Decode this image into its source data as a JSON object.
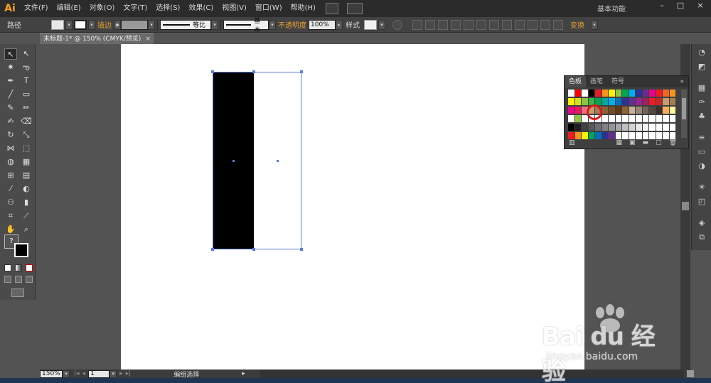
{
  "app": {
    "logo": "Ai"
  },
  "menu": [
    "文件(F)",
    "编辑(E)",
    "对象(O)",
    "文字(T)",
    "选择(S)",
    "效果(C)",
    "视图(V)",
    "窗口(W)",
    "帮助(H)"
  ],
  "workspace": "基本功能",
  "window_controls": {
    "minimize": "–",
    "maximize": "□",
    "close": "×"
  },
  "control_bar": {
    "selection_type": "路径",
    "stroke_label": "描边",
    "stroke_profile": "等比",
    "brush": "基本",
    "opacity_label": "不透明度",
    "opacity_value": "100%",
    "style_label": "样式",
    "transform_label": "变换"
  },
  "document": {
    "tab_title": "未标题-1* @ 150% (CMYK/预览)",
    "tab_close": "×"
  },
  "swatches_panel": {
    "tabs": [
      "色板",
      "画笔",
      "符号"
    ],
    "menu_icon": "»",
    "footer_icon": "lib-icon",
    "rows": [
      [
        "#ffffff",
        "#ff0000",
        "#ffffff",
        "#000000",
        "#e31e24",
        "#f7941d",
        "#fff200",
        "#8dc63f",
        "#00a651",
        "#00aeef",
        "#2e3192",
        "#662d91",
        "#ec008c",
        "#ed1c24",
        "#f26522",
        "#f7941d"
      ],
      [
        "#fff200",
        "#d7df23",
        "#8dc63f",
        "#39b54a",
        "#00a651",
        "#00a99d",
        "#00aeef",
        "#0072bc",
        "#2e3192",
        "#662d91",
        "#92278f",
        "#9e1f63",
        "#ed1c24",
        "#c1272d",
        "#c69c6d",
        "#a67c52"
      ],
      [
        "#ec008c",
        "#ed145b",
        "#f26d7d",
        "#c69c6d",
        "#a67c52",
        "#8c6239",
        "#754c24",
        "#603913",
        "#8c6239",
        "#c7b299",
        "#998675",
        "#736357",
        "#534741",
        "#362f2d",
        "#fbaf5d",
        "#fff799"
      ],
      [
        "#ffffff",
        "#8dc63f",
        "#ffffff",
        "#ffffff",
        "#ffffff",
        "#ffffff",
        "#ffffff",
        "#ffffff",
        "#ffffff",
        "#ffffff",
        "#ffffff",
        "#ffffff",
        "#ffffff",
        "#ffffff",
        "#ffffff",
        "#ffffff"
      ],
      [
        "#000000",
        "#231f20",
        "#414042",
        "#58595b",
        "#6d6e71",
        "#808285",
        "#939598",
        "#a7a9ac",
        "#bcbec0",
        "#d1d3d4",
        "#e6e7e8",
        "#f1f2f2",
        "#ffffff",
        "#ffffff",
        "#ffffff",
        "#ffffff"
      ],
      [
        "#ed1c24",
        "#f7941d",
        "#fff200",
        "#00a651",
        "#0072bc",
        "#2e3192",
        "#662d91",
        "#ffffff",
        "#ffffff",
        "#ffffff",
        "#ffffff",
        "#ffffff",
        "#ffffff",
        "#ffffff",
        "#ffffff",
        "#ffffff"
      ]
    ]
  },
  "status_bar": {
    "zoom": "150%",
    "page": "1",
    "tool_status": "编组选择"
  },
  "watermark": {
    "main": "Bai du 经验",
    "sub": "jingyan.baidu.com"
  },
  "colors": {
    "accent_orange": "#e8a030",
    "selection_blue": "#5a7bd8",
    "highlight_red": "#e01818"
  }
}
